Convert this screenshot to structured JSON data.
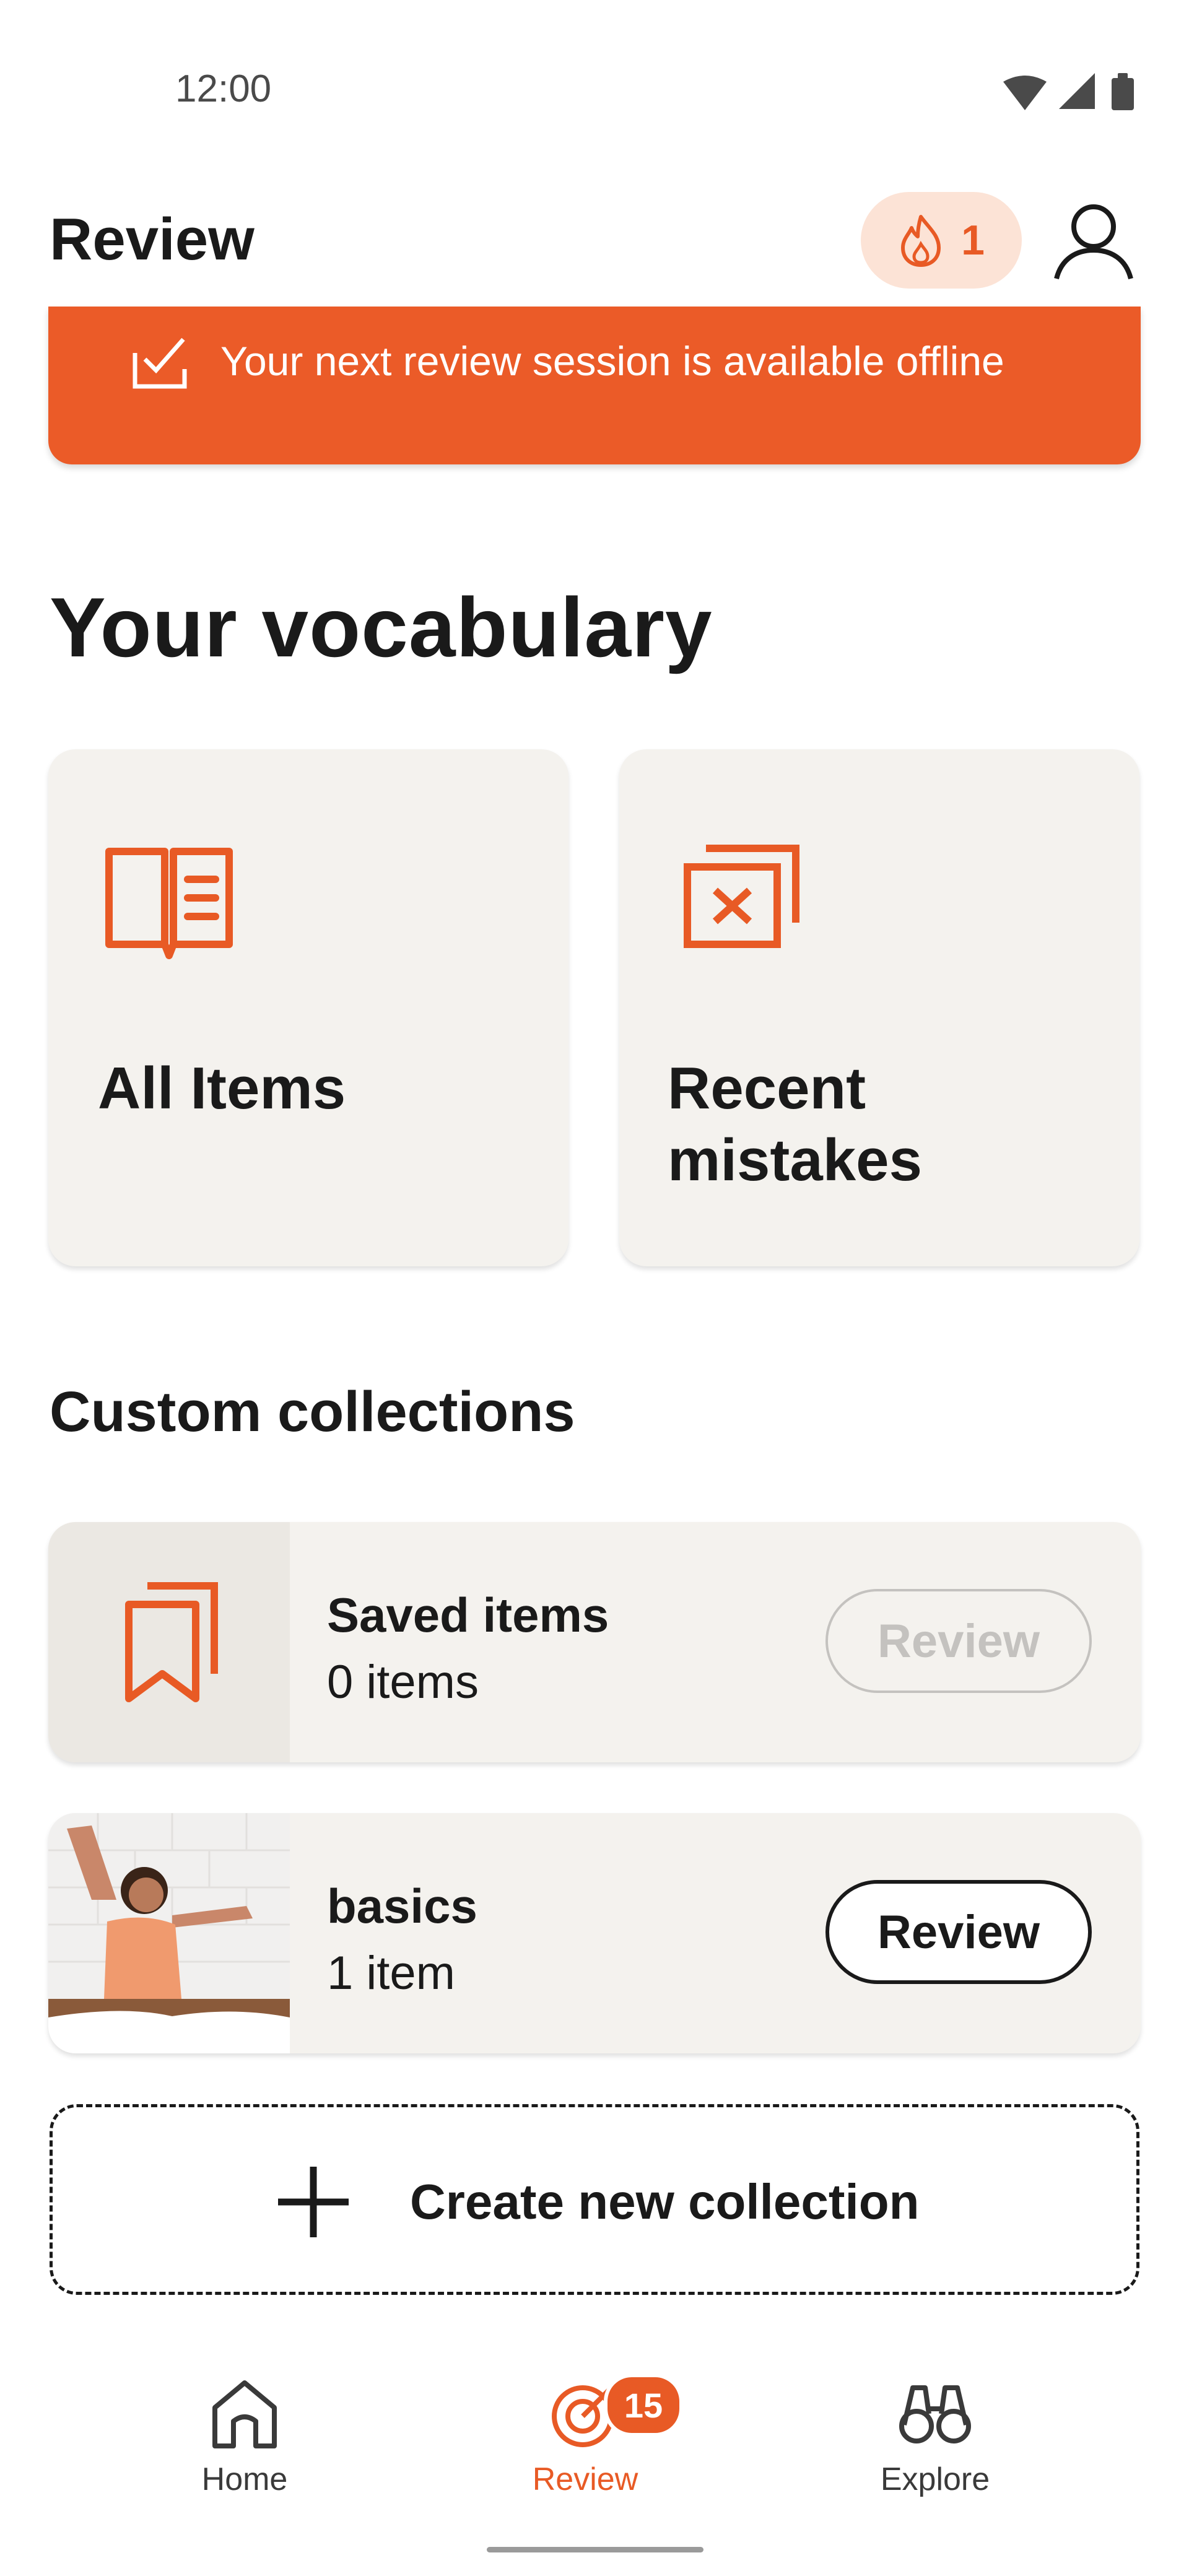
{
  "status_bar": {
    "time": "12:00"
  },
  "header": {
    "title": "Review",
    "streak_count": "1"
  },
  "banner": {
    "text": "Your next review session is available offline"
  },
  "vocabulary": {
    "title": "Your vocabulary",
    "cards": [
      {
        "label": "All Items"
      },
      {
        "label": "Recent mistakes"
      }
    ]
  },
  "collections": {
    "title": "Custom collections",
    "items": [
      {
        "title": "Saved items",
        "subtitle": "0 items",
        "button": "Review",
        "button_enabled": false
      },
      {
        "title": "basics",
        "subtitle": "1 item",
        "button": "Review",
        "button_enabled": true
      }
    ],
    "create_label": "Create new collection"
  },
  "bottom_nav": {
    "items": [
      {
        "label": "Home"
      },
      {
        "label": "Review",
        "badge": "15",
        "active": true
      },
      {
        "label": "Explore"
      }
    ]
  },
  "colors": {
    "accent": "#eb5b28",
    "card": "#f4f2ee",
    "streak_bg": "#fce3d6"
  }
}
